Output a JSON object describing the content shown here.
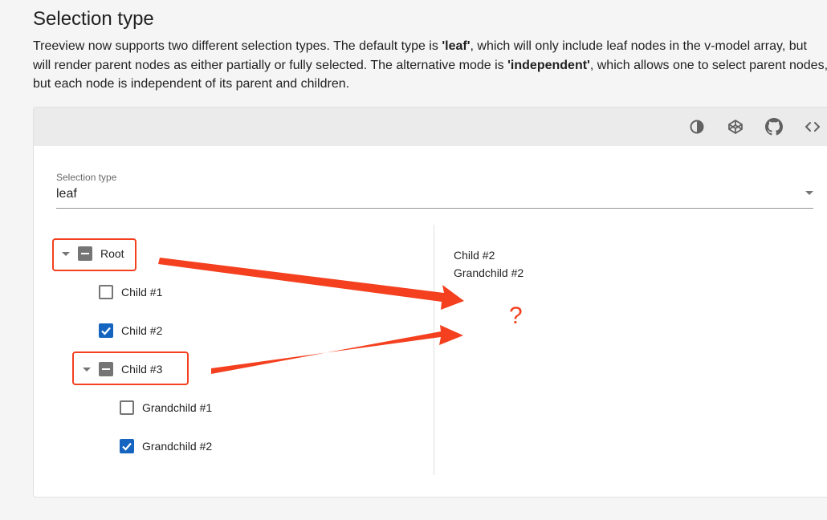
{
  "section": {
    "title": "Selection type",
    "description": {
      "p1": "Treeview now supports two different selection types. The default type is ",
      "leaf": "'leaf'",
      "p2": ", which will only include leaf nodes in the v-model array, but will render parent nodes as either partially or fully selected. The alternative mode is ",
      "independent": "'independent'",
      "p3": ", which allows one to select parent nodes, but each node is independent of its parent and children."
    }
  },
  "toolbar": {
    "icons": [
      "theme-invert-icon",
      "codepen-icon",
      "github-icon",
      "code-icon"
    ]
  },
  "select": {
    "label": "Selection type",
    "value": "leaf"
  },
  "tree": {
    "root": {
      "label": "Root",
      "state": "partial",
      "expanded": true
    },
    "child1": {
      "label": "Child #1",
      "state": "unchecked"
    },
    "child2": {
      "label": "Child #2",
      "state": "checked"
    },
    "child3": {
      "label": "Child #3",
      "state": "partial",
      "expanded": true
    },
    "grandchild1": {
      "label": "Grandchild #1",
      "state": "unchecked"
    },
    "grandchild2": {
      "label": "Grandchild #2",
      "state": "checked"
    }
  },
  "selected": [
    "Child #2",
    "Grandchild #2"
  ],
  "annotation": {
    "mark": "?",
    "color": "#f4401f"
  }
}
